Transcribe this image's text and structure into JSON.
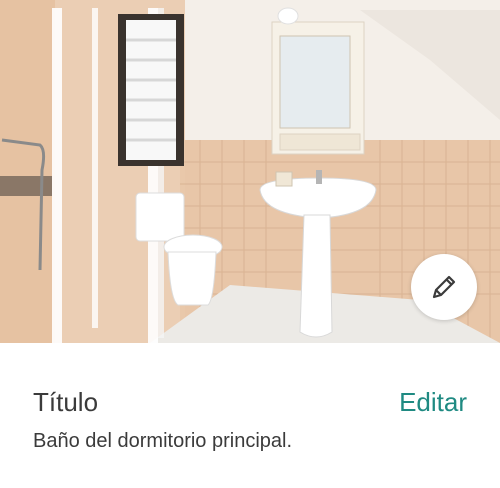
{
  "photo": {
    "alt_name": "bathroom-photo"
  },
  "actions": {
    "edit_fab_icon": "pencil-icon"
  },
  "section": {
    "title": "Título",
    "edit_label": "Editar",
    "description": "Baño del dormitorio principal."
  },
  "colors": {
    "accent": "#1f8a82",
    "text": "#3b3b3b"
  }
}
